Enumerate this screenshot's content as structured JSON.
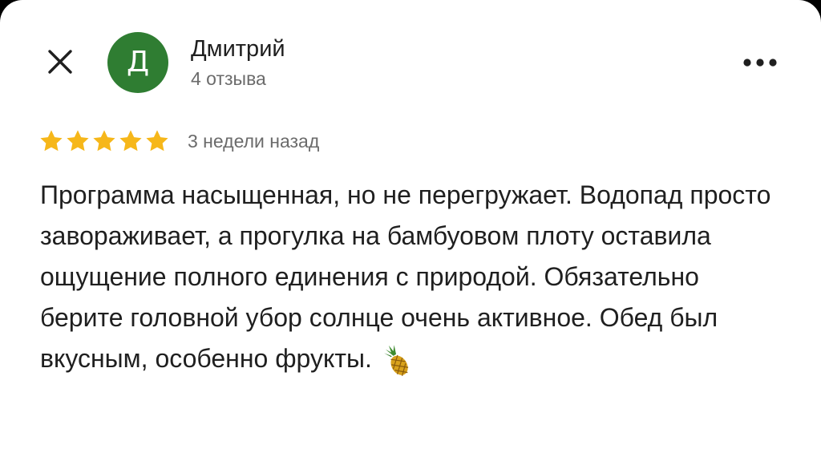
{
  "header": {
    "close_icon": "close-icon",
    "more_icon": "more-horizontal-icon"
  },
  "author": {
    "avatar_letter": "Д",
    "avatar_color": "#2f7d32",
    "name": "Дмитрий",
    "reviews_count": "4 отзыва"
  },
  "review": {
    "rating": 5,
    "rating_max": 5,
    "star_color": "#f6b71a",
    "date": "3 недели назад",
    "text": "Программа насыщенная, но не перегружает. Водопад просто завораживает, а прогулка на бамбуовом плоту оставила ощущение полного единения с природой. Обязательно берите головной убор солнце очень активное. Обед был вкусным, особенно фрукты.",
    "emoji_icon": "pineapple-icon"
  }
}
